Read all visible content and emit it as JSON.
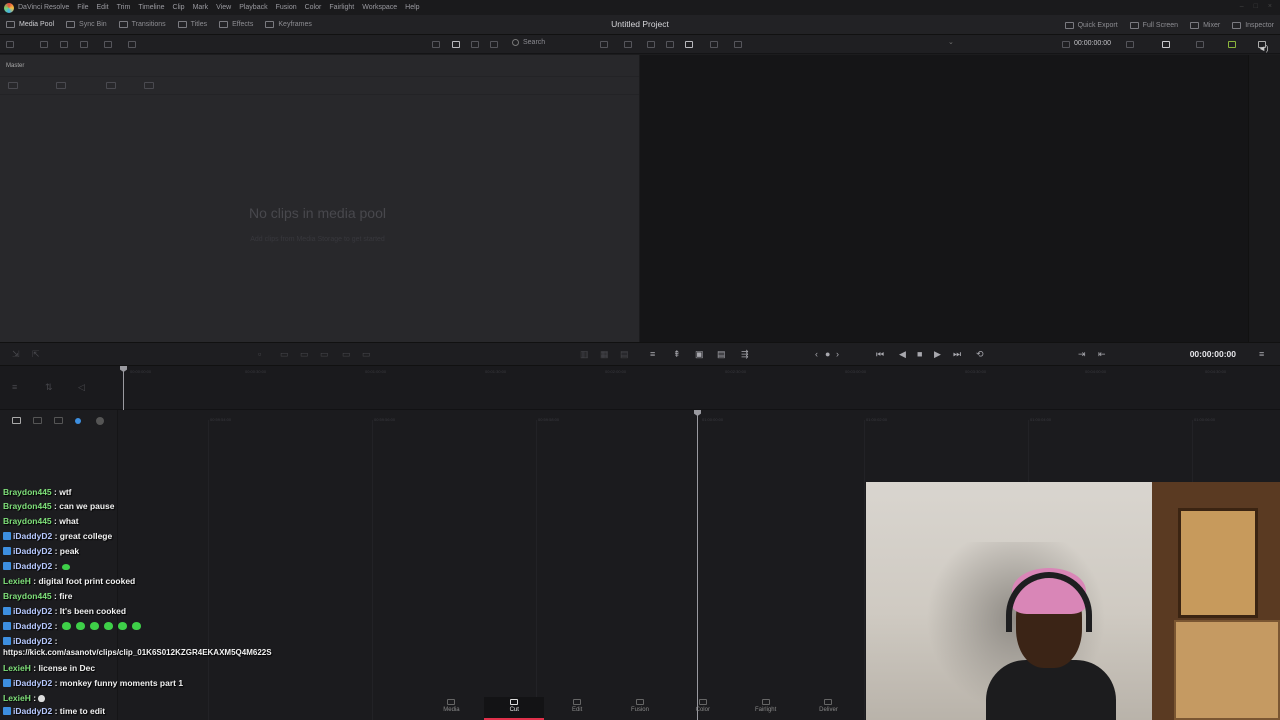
{
  "menubar": {
    "app_name": "DaVinci Resolve",
    "items": [
      "File",
      "Edit",
      "Trim",
      "Timeline",
      "Clip",
      "Mark",
      "View",
      "Playback",
      "Fusion",
      "Color",
      "Fairlight",
      "Workspace",
      "Help"
    ]
  },
  "toolbar": {
    "media_pool": "Media Pool",
    "sync_bin": "Sync Bin",
    "transitions": "Transitions",
    "titles": "Titles",
    "effects": "Effects",
    "keyframes": "Keyframes",
    "project_title": "Untitled Project",
    "quick_export": "Quick Export",
    "full_screen": "Full Screen",
    "mixer": "Mixer",
    "inspector": "Inspector"
  },
  "subbar": {
    "search_placeholder": "Search",
    "timecode": "00:00:00:00"
  },
  "media_pool": {
    "bin_name": "Master",
    "empty_title": "No clips in media pool",
    "empty_subtitle": "Add clips from Media Storage to get started"
  },
  "controls": {
    "timecode": "00:00:00:00"
  },
  "chat": {
    "lines": [
      {
        "user": "Braydon445",
        "text": ": wtf",
        "badge": false,
        "color": "green"
      },
      {
        "user": "Braydon445",
        "text": ": can we pause",
        "badge": false,
        "color": "green"
      },
      {
        "user": "Braydon445",
        "text": ": what",
        "badge": false,
        "color": "green"
      },
      {
        "user": "iDaddyD2",
        "text": ": great college",
        "badge": true,
        "color": "blue"
      },
      {
        "user": "iDaddyD2",
        "text": ": peak",
        "badge": true,
        "color": "blue"
      },
      {
        "user": "iDaddyD2",
        "text": ":",
        "badge": true,
        "color": "blue",
        "emotes": 1
      },
      {
        "user": "LexieH",
        "text": ": digital foot print cooked",
        "badge": false,
        "color": "green"
      },
      {
        "user": "Braydon445",
        "text": ": fire",
        "badge": false,
        "color": "green"
      },
      {
        "user": "iDaddyD2",
        "text": ": It's been cooked",
        "badge": true,
        "color": "blue"
      },
      {
        "user": "iDaddyD2",
        "text": ":",
        "badge": true,
        "color": "blue",
        "emotes": 6
      },
      {
        "user": "iDaddyD2",
        "text": ":",
        "badge": true,
        "color": "blue"
      },
      {
        "user": "",
        "text": "https://kick.com/asanotv/clips/clip_01K6S012KZGR4EKAXM5Q4M622S",
        "badge": false,
        "color": "white"
      },
      {
        "user": "LexieH",
        "text": ": license in Dec",
        "badge": false,
        "color": "green"
      },
      {
        "user": "iDaddyD2",
        "text": ": monkey funny moments part 1",
        "badge": true,
        "color": "blue"
      },
      {
        "user": "LexieH",
        "text": ":",
        "badge": false,
        "color": "green"
      },
      {
        "user": "iDaddyD2",
        "text": ": time to edit",
        "badge": true,
        "color": "blue"
      }
    ]
  },
  "pages": [
    "Media",
    "Cut",
    "Edit",
    "Fusion",
    "Color",
    "Fairlight",
    "Deliver"
  ],
  "active_page": "Cut",
  "colors": {
    "accent": "#e0304a",
    "username_green": "#7fe07a",
    "username_blue": "#b7c9ff",
    "badge": "#3d8fe0"
  }
}
